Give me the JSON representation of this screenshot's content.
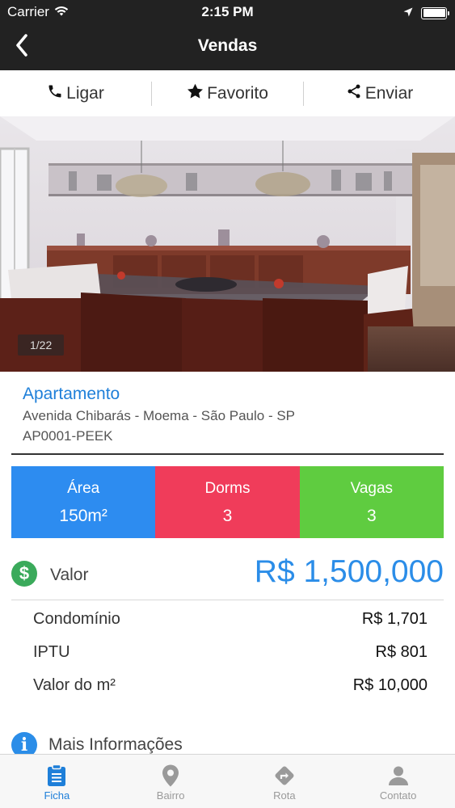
{
  "status_bar": {
    "carrier": "Carrier",
    "time": "2:15 PM",
    "icons": [
      "wifi-icon",
      "location-arrow-icon",
      "battery-icon"
    ]
  },
  "nav": {
    "title": "Vendas",
    "back_icon": "chevron-left-icon"
  },
  "actions": [
    {
      "label": "Ligar",
      "icon": "phone-icon"
    },
    {
      "label": "Favorito",
      "icon": "star-icon"
    },
    {
      "label": "Enviar",
      "icon": "share-icon"
    }
  ],
  "photo": {
    "counter": "1/22"
  },
  "listing": {
    "type": "Apartamento",
    "address": "Avenida Chibarás - Moema - São Paulo - SP",
    "code": "AP0001-PEEK"
  },
  "stats": [
    {
      "label": "Área",
      "value": "150m²",
      "color": "#2d8cf0"
    },
    {
      "label": "Dorms",
      "value": "3",
      "color": "#f03c5a"
    },
    {
      "label": "Vagas",
      "value": "3",
      "color": "#5fcc40"
    }
  ],
  "price": {
    "icon": "dollar-icon",
    "label": "Valor",
    "value": "R$ 1,500,000"
  },
  "fees": [
    {
      "label": "Condomínio",
      "value": "R$ 1,701"
    },
    {
      "label": "IPTU",
      "value": "R$ 801"
    },
    {
      "label": "Valor do m²",
      "value": "R$ 10,000"
    }
  ],
  "more_info": {
    "label": "Mais Informações",
    "icon": "info-icon"
  },
  "tabs": [
    {
      "label": "Ficha",
      "icon": "clipboard-icon",
      "active": true
    },
    {
      "label": "Bairro",
      "icon": "map-pin-icon",
      "active": false
    },
    {
      "label": "Rota",
      "icon": "route-sign-icon",
      "active": false
    },
    {
      "label": "Contato",
      "icon": "person-icon",
      "active": false
    }
  ],
  "colors": {
    "bar_dark": "#222222",
    "accent_blue": "#2b8de8",
    "dollar_green": "#3aaa5b"
  }
}
